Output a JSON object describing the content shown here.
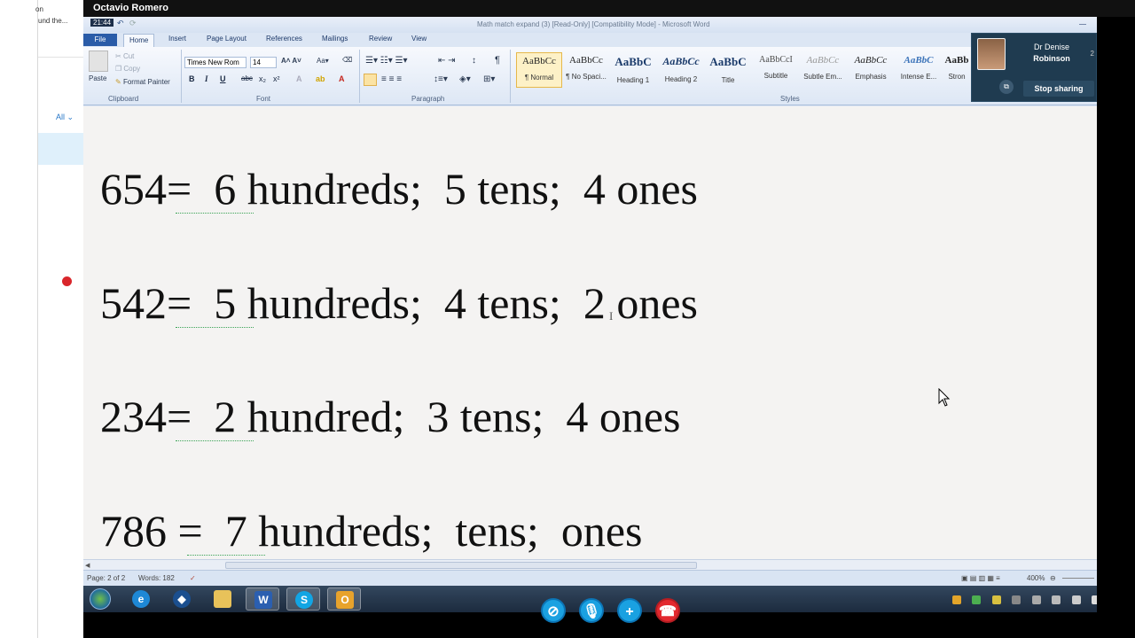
{
  "call": {
    "caller_name": "Octavio Romero",
    "participant_name_line1": "Dr Denise",
    "participant_name_line2": "Robinson",
    "participant_count": "2",
    "stop_sharing_label": "Stop sharing"
  },
  "skype_sidebar": {
    "text1": "on",
    "text2": "und the...",
    "filter_label": "All"
  },
  "word": {
    "clock": "21:44",
    "window_title": "Math match expand (3) [Read-Only] [Compatibility Mode] - Microsoft Word",
    "tabs": [
      "File",
      "Home",
      "Insert",
      "Page Layout",
      "References",
      "Mailings",
      "Review",
      "View"
    ],
    "clipboard": {
      "paste": "Paste",
      "cut": "Cut",
      "copy": "Copy",
      "format_painter": "Format Painter",
      "group": "Clipboard"
    },
    "font": {
      "name": "Times New Rom",
      "size": "14",
      "group": "Font"
    },
    "paragraph_group": "Paragraph",
    "styles_group": "Styles",
    "styles": [
      {
        "preview": "AaBbCc",
        "name": "¶ Normal"
      },
      {
        "preview": "AaBbCc",
        "name": "¶ No Spaci..."
      },
      {
        "preview": "AaBbC",
        "name": "Heading 1"
      },
      {
        "preview": "AaBbCc",
        "name": "Heading 2"
      },
      {
        "preview": "AaBbC",
        "name": "Title"
      },
      {
        "preview": "AaBbCcI",
        "name": "Subtitle"
      },
      {
        "preview": "AaBbCc",
        "name": "Subtle Em..."
      },
      {
        "preview": "AaBbCc",
        "name": "Emphasis"
      },
      {
        "preview": "AaBbC",
        "name": "Intense E..."
      },
      {
        "preview": "AaBb",
        "name": "Stron"
      }
    ],
    "document_lines": [
      "654=  6 hundreds;  5 tens;  4 ones",
      "542=  5 hundreds;  4 tens;  2 ones",
      "234=  2 hundred;  3 tens;  4 ones",
      "786 =  7 hundreds;  tens;  ones"
    ],
    "status": {
      "page": "Page: 2 of 2",
      "words": "Words: 182",
      "zoom": "400%"
    }
  }
}
